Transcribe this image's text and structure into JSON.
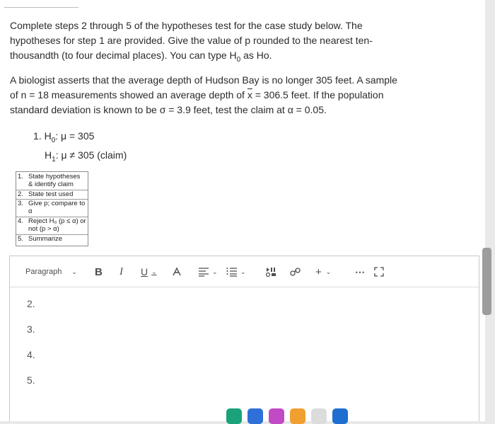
{
  "instructions": {
    "part1": "Complete steps 2 through 5 of the hypotheses test for the case study below. The hypotheses for step 1 are provided. Give the value of p rounded to the nearest ten-thousandth (to four decimal places). You can type H",
    "sub0": "0",
    "part2": " as Ho."
  },
  "case_study": {
    "s1": "A biologist asserts that the average depth of Hudson Bay is no longer 305 feet. A sample of n = 18 measurements showed an average depth of ",
    "xbar": "x",
    "s2": " = 306.5 feet. If the population standard deviation is known to be σ = 3.9 feet, test the claim at α = 0.05."
  },
  "hypotheses": {
    "h0_prefix": "1. H",
    "h0_sub": "0",
    "h0_rest": ": μ = 305",
    "h1_prefix": "H",
    "h1_sub": "1",
    "h1_rest": ": μ ≠ 305 (claim)"
  },
  "steps_box": {
    "items": [
      {
        "num": "1.",
        "text": "State hypotheses & identify claim"
      },
      {
        "num": "2.",
        "text": "State test used"
      },
      {
        "num": "3.",
        "text": "Give p; compare to α"
      },
      {
        "num": "4.",
        "text": "Reject H₀ (p ≤ α) or not (p > α)"
      },
      {
        "num": "5.",
        "text": "Summarize"
      }
    ]
  },
  "editor": {
    "paragraph_label": "Paragraph",
    "bold": "B",
    "italic": "I",
    "underline": "U",
    "more": "⋯",
    "add": "+",
    "lines": [
      "2.",
      "3.",
      "4.",
      "5."
    ]
  },
  "colors": {
    "toolbar_icon": "#4d4d4d",
    "scrollbar": "#9d9d9d"
  }
}
